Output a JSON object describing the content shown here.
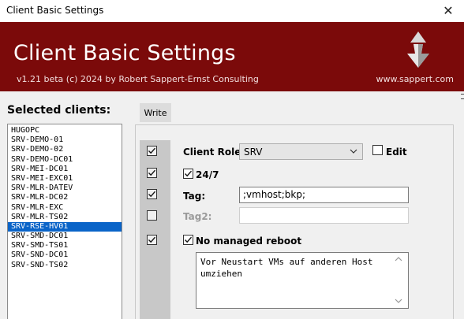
{
  "window": {
    "title": "Client Basic Settings",
    "close_glyph": "✕"
  },
  "banner": {
    "title": "Client Basic Settings",
    "version": "v1.21 beta (c) 2024 by Robert Sappert-Ernst Consulting",
    "website": "www.sappert.com",
    "logo_icon": "sappert-logo-icon",
    "background_color": "#7b0a0a"
  },
  "clients": {
    "label": "Selected clients:",
    "items": [
      "HUGOPC",
      "SRV-DEMO-01",
      "SRV-DEMO-02",
      "SRV-DEMO-DC01",
      "SRV-MEI-DC01",
      "SRV-MEI-EXC01",
      "SRV-MLR-DATEV",
      "SRV-MLR-DC02",
      "SRV-MLR-EXC",
      "SRV-MLR-TS02",
      "SRV-RSE-HV01",
      "SRV-SMD-DC01",
      "SRV-SMD-TS01",
      "SRV-SND-DC01",
      "SRV-SND-TS02"
    ],
    "selected_index": 10,
    "selected_color": "#0a64c8"
  },
  "toolbar": {
    "write_label": "Write"
  },
  "settings": {
    "apply_checkboxes": [
      true,
      true,
      true,
      false,
      true
    ],
    "client_role": {
      "label": "Client Role:",
      "value": "SRV"
    },
    "edit": {
      "label": "Edit",
      "checked": false
    },
    "twenty_four_seven": {
      "label": "24/7",
      "checked": true
    },
    "tag": {
      "label": "Tag:",
      "value": ";vmhost;bkp;"
    },
    "tag2": {
      "label": "Tag2:",
      "value": ""
    },
    "no_managed_reboot": {
      "label": "No managed reboot",
      "checked": true
    },
    "notes": "Vor Neustart VMs auf anderen Host umziehen"
  }
}
